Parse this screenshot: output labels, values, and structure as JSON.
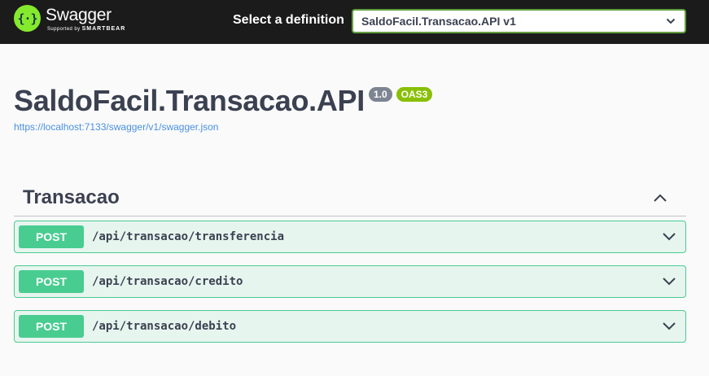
{
  "topbar": {
    "brand_name": "Swagger",
    "brand_sub_prefix": "Supported by ",
    "brand_sub_company": "SMARTBEAR",
    "definition_label": "Select a definition",
    "definition_value": "SaldoFacil.Transacao.API v1"
  },
  "info": {
    "title": "SaldoFacil.Transacao.API",
    "version": "1.0",
    "oas": "OAS3",
    "spec_url": "https://localhost:7133/swagger/v1/swagger.json"
  },
  "tag": {
    "name": "Transacao",
    "operations": [
      {
        "method": "POST",
        "path": "/api/transacao/transferencia"
      },
      {
        "method": "POST",
        "path": "/api/transacao/credito"
      },
      {
        "method": "POST",
        "path": "/api/transacao/debito"
      }
    ]
  },
  "colors": {
    "topbar": "#1b1b1b",
    "logo": "#85ea2d",
    "post": "#49cc90",
    "version_badge": "#7d8492",
    "oas_badge": "#89bf04",
    "link": "#4990e2"
  }
}
